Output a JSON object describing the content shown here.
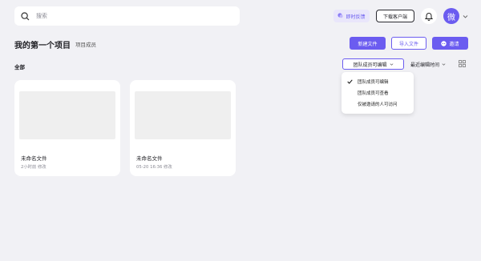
{
  "header": {
    "search_placeholder": "搜索",
    "feedback_label": "即时反馈",
    "download_label": "下载客户端",
    "avatar_text": "微"
  },
  "project": {
    "title": "我的第一个项目",
    "members_link": "项目成员",
    "new_file_label": "新建文件",
    "import_file_label": "导入文件",
    "invite_label": "邀请"
  },
  "filter": {
    "all_label": "全部",
    "permission_selected": "团队成员可编辑",
    "sort_selected": "最近编辑时间"
  },
  "dropdown": {
    "items": [
      {
        "label": "团队成员可编辑",
        "checked": true
      },
      {
        "label": "团队成员可查看",
        "checked": false
      },
      {
        "label": "仅被邀请的人可访问",
        "checked": false
      }
    ]
  },
  "files": [
    {
      "name": "未命名文件",
      "meta": "2小时前 修改"
    },
    {
      "name": "未命名文件",
      "meta": "05-20 16:36 修改"
    }
  ],
  "colors": {
    "accent": "#6b5cf0",
    "background": "#f1f1f5"
  }
}
